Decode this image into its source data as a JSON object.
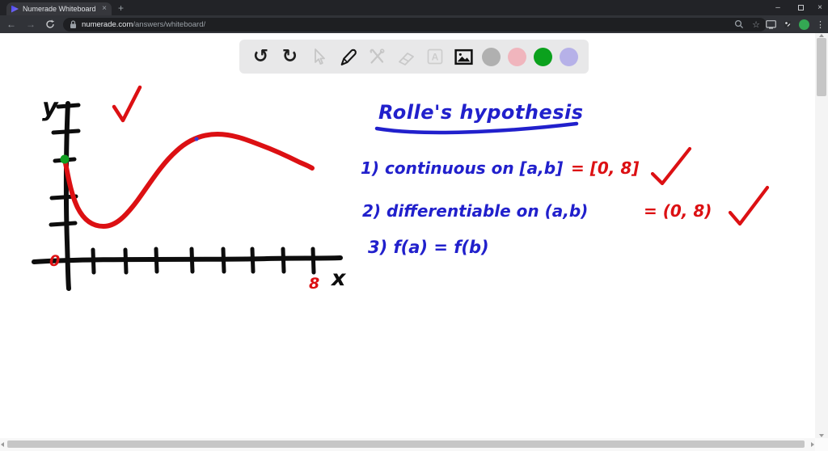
{
  "browser": {
    "tab_title": "Numerade Whiteboard",
    "tab_close": "×",
    "new_tab": "+",
    "minimize": "–",
    "close": "×",
    "back": "←",
    "forward": "→",
    "star": "☆",
    "menu": "⋮",
    "url_domain": "numerade.com",
    "url_path": "/answers/whiteboard/"
  },
  "toolbar": {
    "undo": "↺",
    "redo": "↻",
    "text_glyph": "A"
  },
  "whiteboard": {
    "graph": {
      "y_label": "y",
      "x_label": "x",
      "origin": "0",
      "x_end": "8"
    },
    "notes": {
      "title": "Rolle's hypothesis",
      "item1": "1) continuous on [a,b]",
      "item1_value": "= [0, 8]",
      "item2": "2) differentiable  on (a,b)",
      "item2_value": "= (0, 8)",
      "item3": "3) f(a) = f(b)"
    }
  },
  "colors": {
    "ink_black": "#0d0d0d",
    "ink_red": "#dc1013",
    "ink_blue": "#2120cc",
    "ink_green": "#12a023",
    "swatch_gray": "#b0b0b0",
    "swatch_pink": "#f0b5bd",
    "swatch_green": "#0ba11d",
    "swatch_purple": "#b6b1e8",
    "chrome_dark": "#222327",
    "toolbar_bg": "#e8e8e9"
  }
}
